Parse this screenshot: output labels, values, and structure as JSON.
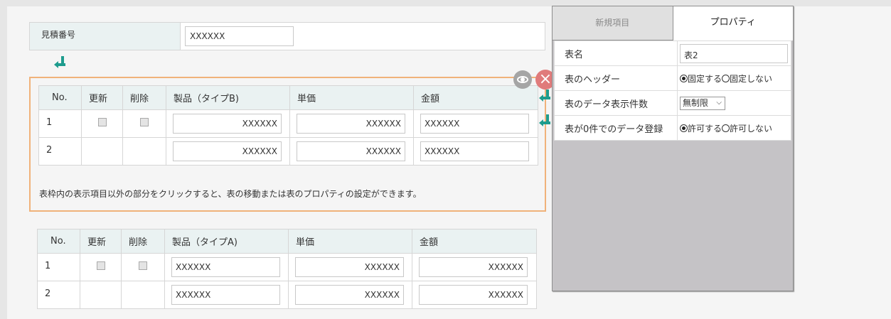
{
  "estimate": {
    "label": "見積番号",
    "value": "XXXXXX"
  },
  "table_b": {
    "headers": [
      "No.",
      "更新",
      "削除",
      "製品（タイプB)",
      "単価",
      "金額"
    ],
    "rows": [
      {
        "no": "1",
        "product": "XXXXXX",
        "price": "XXXXXX",
        "amount": "XXXXXX"
      },
      {
        "no": "2",
        "product": "XXXXXX",
        "price": "XXXXXX",
        "amount": "XXXXXX"
      }
    ],
    "note": "表枠内の表示項目以外の部分をクリックすると、表の移動または表のプロパティの設定ができます。"
  },
  "table_a": {
    "headers": [
      "No.",
      "更新",
      "削除",
      "製品（タイプA)",
      "単価",
      "金額"
    ],
    "rows": [
      {
        "no": "1",
        "product": "XXXXXX",
        "price": "XXXXXX",
        "amount": "XXXXXX"
      },
      {
        "no": "2",
        "product": "XXXXXX",
        "price": "XXXXXX",
        "amount": "XXXXXX"
      }
    ]
  },
  "panel": {
    "tabs": [
      "新規項目",
      "プロパティ"
    ],
    "props": {
      "name_label": "表名",
      "name_value": "表2",
      "header_label": "表のヘッダー",
      "header_opt1": "固定する",
      "header_opt2": "固定しない",
      "count_label": "表のデータ表示件数",
      "count_value": "無制限",
      "zero_label": "表が0件でのデータ登録",
      "zero_opt1": "許可する",
      "zero_opt2": "許可しない"
    }
  },
  "colors": {
    "accent": "#1e9c8e",
    "selection": "#f0b27a",
    "delete": "#e07b7b",
    "header_bg": "#eaf2f2"
  }
}
